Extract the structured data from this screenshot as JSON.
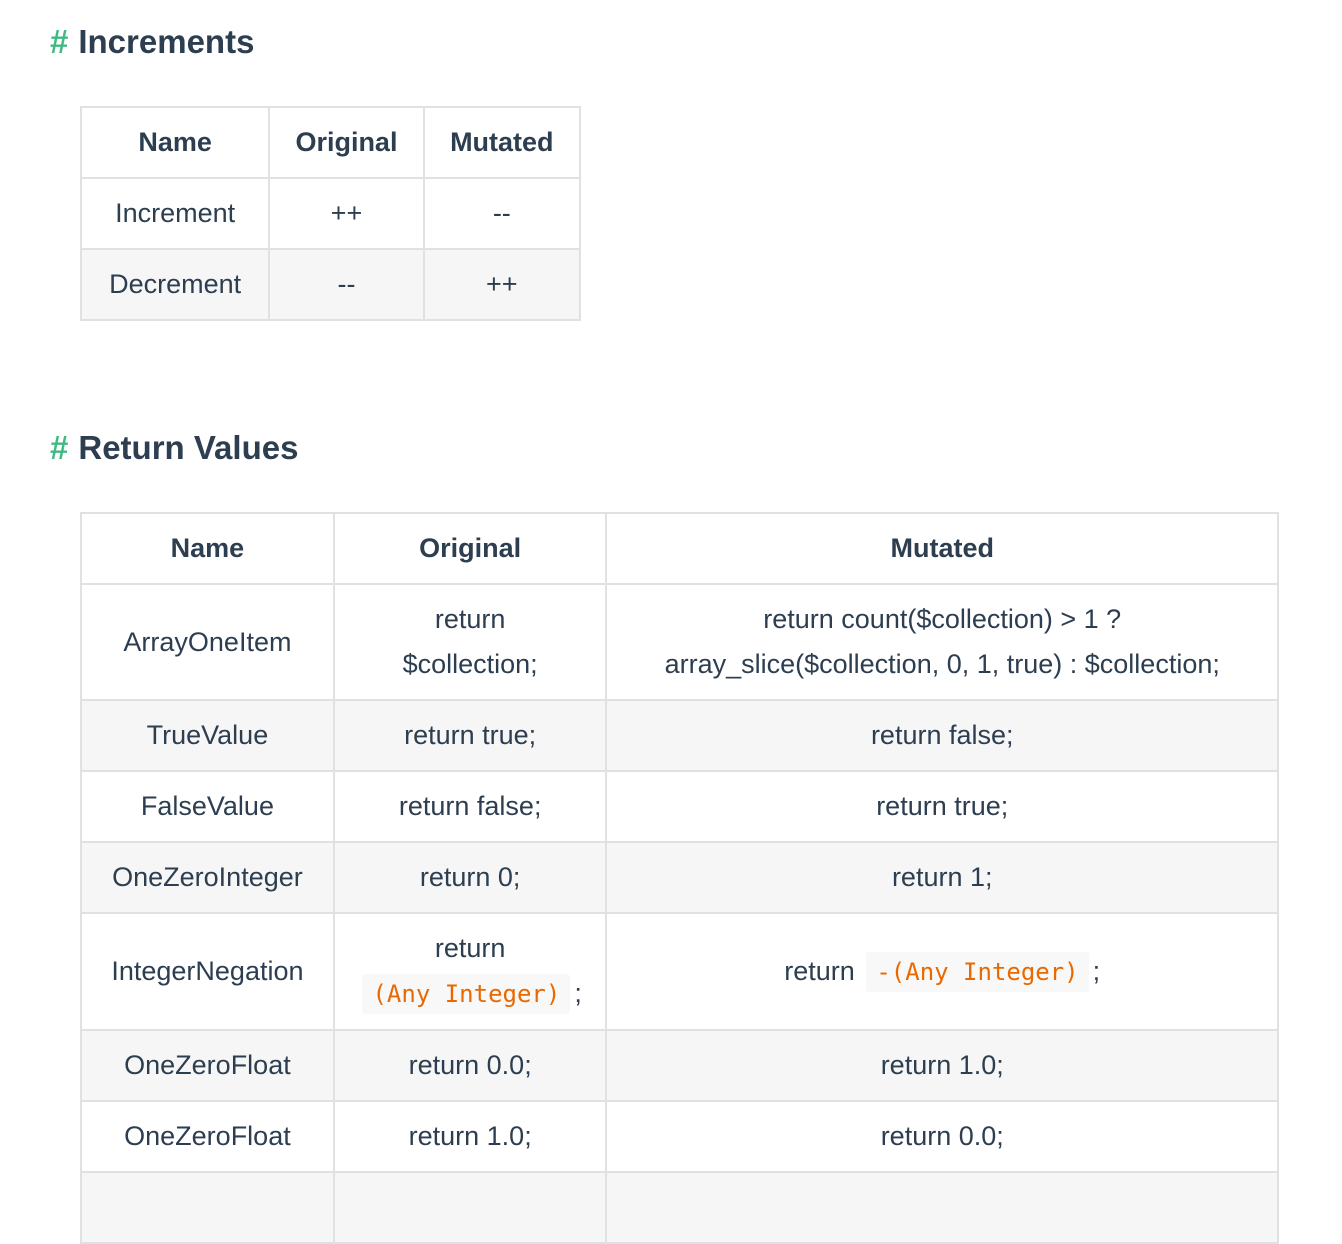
{
  "increments": {
    "heading_hash": "#",
    "heading": "Increments",
    "headers": [
      "Name",
      "Original",
      "Mutated"
    ],
    "rows": [
      {
        "name": "Increment",
        "original": "++",
        "mutated": "--"
      },
      {
        "name": "Decrement",
        "original": "--",
        "mutated": "++"
      }
    ]
  },
  "return_values": {
    "heading_hash": "#",
    "heading": "Return Values",
    "headers": [
      "Name",
      "Original",
      "Mutated"
    ],
    "rows": [
      {
        "name": "ArrayOneItem",
        "original_line1": "return",
        "original_line2": "$collection;",
        "mutated_line1": "return count($collection) > 1 ?",
        "mutated_line2": "array_slice($collection, 0, 1, true) : $collection;"
      },
      {
        "name": "TrueValue",
        "original": "return true;",
        "mutated": "return false;"
      },
      {
        "name": "FalseValue",
        "original": "return false;",
        "mutated": "return true;"
      },
      {
        "name": "OneZeroInteger",
        "original": "return 0;",
        "mutated": "return 1;"
      },
      {
        "name": "IntegerNegation",
        "original_prefix": "return",
        "original_code": "(Any Integer)",
        "original_suffix": ";",
        "mutated_prefix": "return",
        "mutated_code": "-(Any Integer)",
        "mutated_suffix": ";"
      },
      {
        "name": "OneZeroFloat",
        "original": "return 0.0;",
        "mutated": "return 1.0;"
      },
      {
        "name": "OneZeroFloat",
        "original": "return 1.0;",
        "mutated": "return 0.0;"
      }
    ]
  }
}
